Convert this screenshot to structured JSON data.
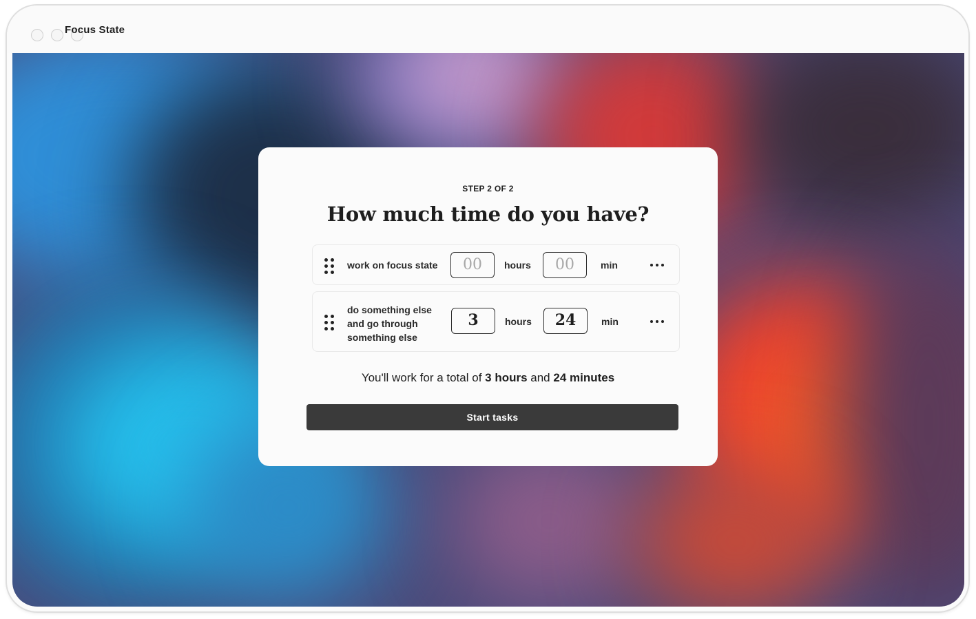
{
  "window": {
    "title": "Focus State"
  },
  "wizard": {
    "step_label": "STEP 2 OF 2",
    "question": "How much time do you have?"
  },
  "tasks": [
    {
      "name": "work on focus state",
      "hours_value": "",
      "hours_placeholder": "00",
      "hours_unit": "hours",
      "minutes_value": "",
      "minutes_placeholder": "00",
      "minutes_unit": "min"
    },
    {
      "name": "do something else and go through something else",
      "hours_value": "3",
      "hours_placeholder": "00",
      "hours_unit": "hours",
      "minutes_value": "24",
      "minutes_placeholder": "00",
      "minutes_unit": "min"
    }
  ],
  "summary": {
    "prefix": "You'll work for a total of ",
    "hours": "3 hours",
    "middle": " and ",
    "minutes": "24 minutes"
  },
  "actions": {
    "start_label": "Start tasks"
  },
  "icons": {
    "drag": "drag-handle-icon",
    "more": "more-horizontal-icon"
  },
  "colors": {
    "button": "#3a3a3a",
    "card": "#fbfbfb",
    "text": "#1e1e1e",
    "placeholder": "#a8a8a8"
  }
}
